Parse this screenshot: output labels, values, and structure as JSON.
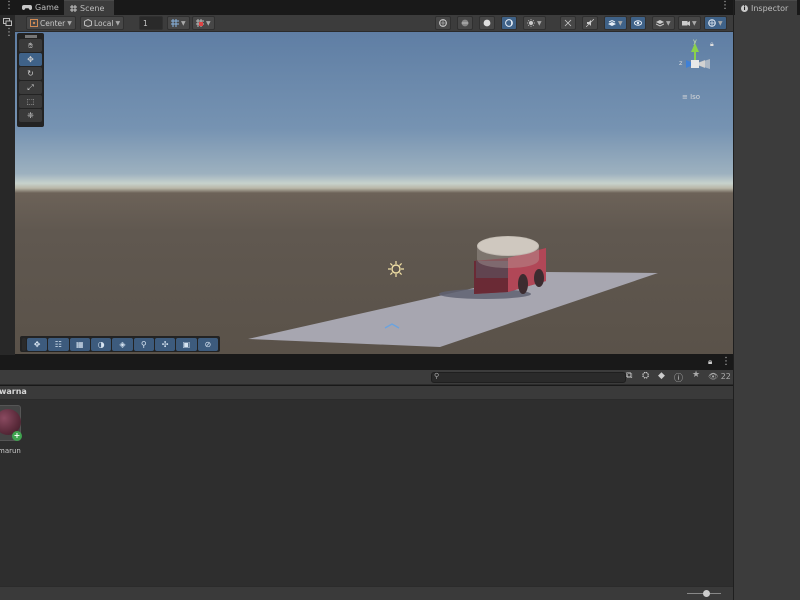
{
  "tabs": [
    {
      "label": "Game",
      "icon": "gamepad-icon",
      "active": false
    },
    {
      "label": "Scene",
      "icon": "grid-icon",
      "active": true
    }
  ],
  "inspector": {
    "label": "Inspector",
    "icon": "info-icon"
  },
  "scene_toolbar": {
    "pivot_label": "Center",
    "space_label": "Local",
    "snap_value": "1"
  },
  "gizmo": {
    "axes": {
      "y": "y",
      "x": "x",
      "z": "z"
    },
    "projection_label": "Iso"
  },
  "project": {
    "folder_label": "warna",
    "asset_label": "marun",
    "visible_count": "22"
  },
  "colors": {
    "accent_blue": "#3f6288",
    "panel": "#3c3c3c",
    "dark": "#191919",
    "car_body": "#a43b4a",
    "car_top": "#c9c1b7"
  }
}
